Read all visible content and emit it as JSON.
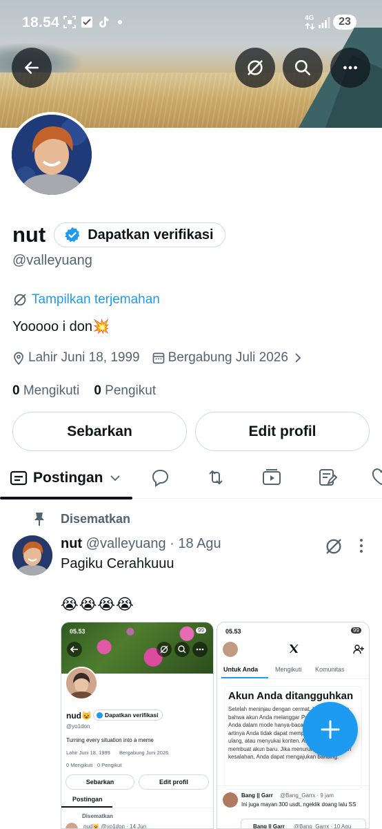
{
  "status_bar": {
    "time": "18.54",
    "network": "4G",
    "battery": "23"
  },
  "profile": {
    "name": "nut",
    "verify_label": "Dapatkan verifikasi",
    "handle": "@valleyuang",
    "translate_label": "Tampilkan terjemahan",
    "bio": "Yooooo i don💥",
    "birthday": "Lahir Juni 18, 1999",
    "joined": "Bergabung Juli 2026",
    "following_count": "0",
    "following_label": "Mengikuti",
    "followers_count": "0",
    "followers_label": "Pengikut",
    "share_label": "Sebarkan",
    "edit_label": "Edit profil"
  },
  "tabs": {
    "active_label": "Postingan"
  },
  "post": {
    "pinned_label": "Disematkan",
    "author": "nut",
    "handle": "@valleyuang",
    "dot": "·",
    "date": "18 Agu",
    "text": "Pagiku Cerahkuuu",
    "emoji": "😭😭😭😭"
  },
  "shot1": {
    "time": "05.53",
    "battery": "99",
    "name": "nud😺",
    "verify_label": "Dapatkan verifikasi",
    "handle": "@yo1don",
    "bio": "Turning every situation into a meme",
    "birthday": "Lahir Juni 18, 1999",
    "joined": "Bergabung Juni 2026",
    "following": "0 Mengikuti",
    "followers": "0 Pengikut",
    "share_label": "Sebarkan",
    "edit_label": "Edit profil",
    "tab_label": "Postingan",
    "pinned_label": "Disematkan",
    "post_head": "nud😺 @yo1don · 14 Jun"
  },
  "shot2": {
    "time": "05.53",
    "battery": "99",
    "tab_for_you": "Untuk Anda",
    "tab_following": "Mengikuti",
    "tab_community": "Komunitas",
    "suspended_title": "Akun Anda ditangguhkan",
    "suspended_body": "Setelah meninjau dengan cermat, X memutuskan bahwa akun Anda melanggar Peraturan X. Akun Anda dalam mode hanya-baca secara permanen, artinya Anda tidak dapat memposting, memposting ulang, atau menyukai konten. Anda tidak dapat membuat akun baru. Jika menurut Anda ini adalah kesalahan, Anda dapat mengajukan banding.",
    "reply_author": "Bang || Garr",
    "reply_handle": "@Bang_Garrx · 9 jam",
    "reply_text": "Ini juga mayan 300 usdt, ngeklik doang lalu SS",
    "quote_author": "Bang || Garr",
    "quote_handle": "@Bang_Garrx · 10 Agu"
  },
  "colors": {
    "accent": "#1d9bf0",
    "text": "#0f1419",
    "muted": "#536471",
    "border": "#cfd9de"
  }
}
